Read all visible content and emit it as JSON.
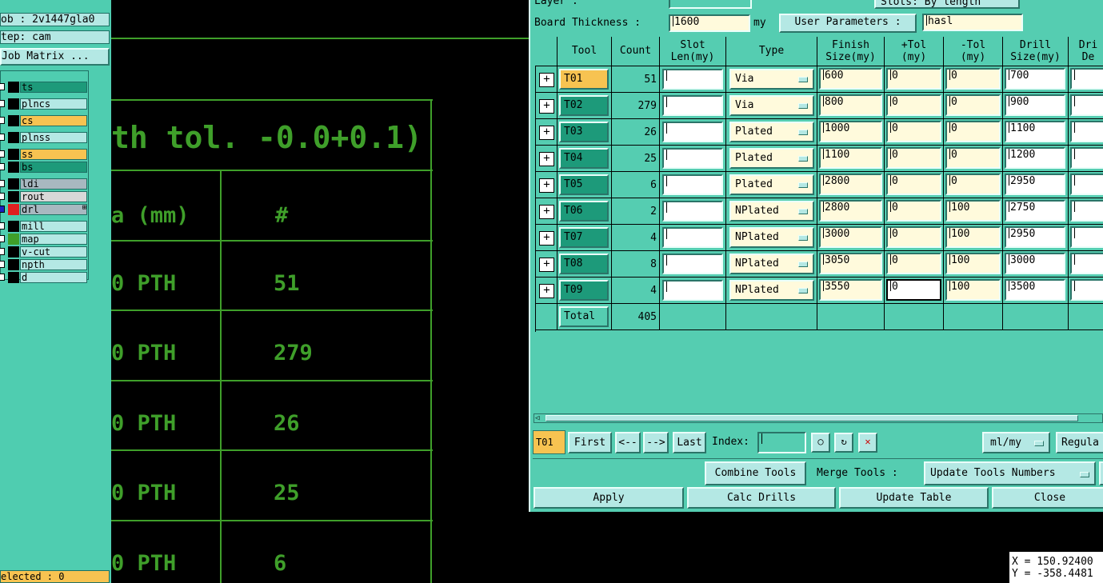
{
  "left_panel": {
    "job": "ob : 2v1447gla0",
    "step": "tep: cam",
    "job_matrix": "Job Matrix ...",
    "layers": [
      {
        "name": "ts",
        "color": "#1d9a7a"
      },
      {
        "name": "plncs",
        "color": "#b4e8e4"
      },
      {
        "name": "cs",
        "color": "#f7c351"
      },
      {
        "name": "plnss",
        "color": "#b4e8e4"
      },
      {
        "name": "ss",
        "color": "#f7c351"
      },
      {
        "name": "bs",
        "color": "#1d9a7a"
      },
      {
        "name": "ldi",
        "color": "#a8b8c0"
      },
      {
        "name": "rout",
        "color": "#d8d8d8"
      },
      {
        "name": "drl",
        "color": "#a8b8c0",
        "marker": "⊞"
      },
      {
        "name": "mill",
        "color": "#b4e8e4"
      },
      {
        "name": "map",
        "color": "#b4e8e4"
      },
      {
        "name": "v-cut",
        "color": "#b4e8e4"
      },
      {
        "name": "npth",
        "color": "#b4e8e4"
      },
      {
        "name": "d",
        "color": "#b4e8e4"
      }
    ],
    "selected": "elected : 0"
  },
  "canvas": {
    "heading": "th tol. -0.0+0.1)",
    "col1_header": "a (mm)",
    "col2_header": "#",
    "rows": [
      {
        "type": "0 PTH",
        "count": "51"
      },
      {
        "type": "0 PTH",
        "count": "279"
      },
      {
        "type": "0 PTH",
        "count": "26"
      },
      {
        "type": "0 PTH",
        "count": "25"
      },
      {
        "type": "0 PTH",
        "count": "6"
      }
    ]
  },
  "dialog": {
    "top_layer_label": "Layer          :",
    "slots_label": "Slots:  By length",
    "board_thickness_label": "Board Thickness :",
    "board_thickness_value": "1600",
    "board_thickness_unit": "my",
    "user_params_label": "User Parameters :",
    "user_params_value": "hasl",
    "headers": {
      "tool": "Tool",
      "count": "Count",
      "slot_len": "Slot\nLen(my)",
      "type": "Type",
      "finish": "Finish\nSize(my)",
      "ptol": "+Tol\n(my)",
      "mtol": "-Tol\n(my)",
      "drill": "Drill\nSize(my)",
      "drill_des": "Dri\nDe"
    },
    "rows": [
      {
        "tool": "T01",
        "count": "51",
        "type": "Via",
        "finish": "600",
        "ptol": "0",
        "mtol": "0",
        "drill": "700"
      },
      {
        "tool": "T02",
        "count": "279",
        "type": "Via",
        "finish": "800",
        "ptol": "0",
        "mtol": "0",
        "drill": "900"
      },
      {
        "tool": "T03",
        "count": "26",
        "type": "Plated",
        "finish": "1000",
        "ptol": "0",
        "mtol": "0",
        "drill": "1100"
      },
      {
        "tool": "T04",
        "count": "25",
        "type": "Plated",
        "finish": "1100",
        "ptol": "0",
        "mtol": "0",
        "drill": "1200"
      },
      {
        "tool": "T05",
        "count": "6",
        "type": "Plated",
        "finish": "2800",
        "ptol": "0",
        "mtol": "0",
        "drill": "2950"
      },
      {
        "tool": "T06",
        "count": "2",
        "type": "NPlated",
        "finish": "2800",
        "ptol": "0",
        "mtol": "100",
        "drill": "2750"
      },
      {
        "tool": "T07",
        "count": "4",
        "type": "NPlated",
        "finish": "3000",
        "ptol": "0",
        "mtol": "100",
        "drill": "2950"
      },
      {
        "tool": "T08",
        "count": "8",
        "type": "NPlated",
        "finish": "3050",
        "ptol": "0",
        "mtol": "100",
        "drill": "3000"
      },
      {
        "tool": "T09",
        "count": "4",
        "type": "NPlated",
        "finish": "3550",
        "ptol": "0",
        "mtol": "100",
        "drill": "3500"
      }
    ],
    "total_label": "Total",
    "total_count": "405",
    "nav": {
      "current": "T01",
      "first": "First",
      "prev": "<--",
      "next": "-->",
      "last": "Last",
      "index_label": "Index:",
      "units": "ml/my",
      "regular": "Regula"
    },
    "combine_tools": "Combine Tools",
    "merge_tools_label": "Merge Tools :",
    "update_tools_numbers": "Update Tools Numbers",
    "apply": "Apply",
    "calc_drills": "Calc Drills",
    "update_table": "Update Table",
    "close": "Close"
  },
  "coords": {
    "x": "X = 150.92400",
    "y": "Y = -358.4481"
  },
  "colors": {
    "panel": "#55cdb1",
    "field_yellow": "#fffadc",
    "tool_orange": "#f7c351",
    "tool_green": "#1d9a7a",
    "graphic_green": "#3f9f2a"
  }
}
